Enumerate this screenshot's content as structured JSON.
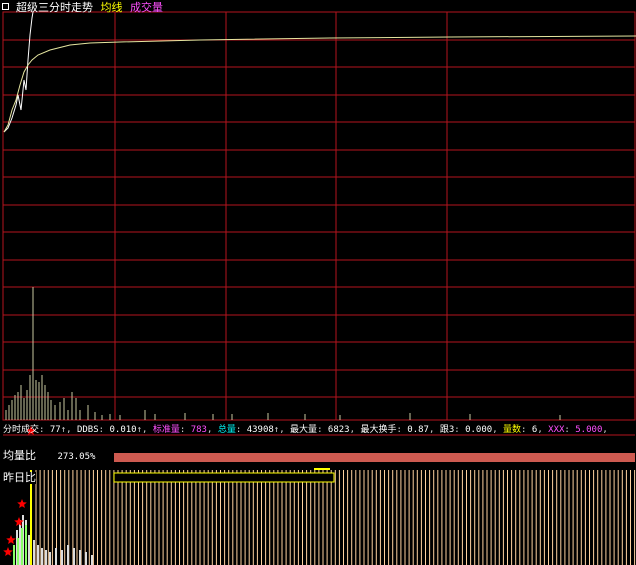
{
  "top_title": {
    "main": "超级三分时走势",
    "avg_line": "均线",
    "volume": "成交量"
  },
  "stats_line": {
    "fenshi_label": "分时成交",
    "fenshi_value": "77",
    "ddbs_label": "DDBS",
    "ddbs_value": "0.010",
    "standard_label": "标准量",
    "standard_value": "783",
    "total_label": "总量",
    "total_value": "43908",
    "max_vol_label": "最大量",
    "max_vol_value": "6823",
    "max_turnover_label": "最大换手",
    "max_turnover_value": "0.87",
    "ex3_label": "跟3",
    "ex3_value": "0.000",
    "count_label": "量数",
    "count_value": "6",
    "xxx_label": "XXX",
    "xxx_value": "5.000"
  },
  "ratio_section": {
    "avg_ratio_label": "均量比",
    "avg_ratio_value": "273.05%",
    "prev_day_label": "昨日比"
  },
  "colors": {
    "grid": "#b4141e",
    "price_line": "#ffffff",
    "avg_line": "#e6e6a0",
    "volume_bar": "#c8c8a0",
    "stripe": "#ffd2a0",
    "bar_fill": "#cd5a50",
    "yellow": "#ffff00",
    "magenta": "#ff50ff",
    "cyan": "#00ffff",
    "red_star": "#ff0000"
  },
  "icons": {
    "corner": "small-square-icon",
    "stars": "red-star-icon"
  }
}
